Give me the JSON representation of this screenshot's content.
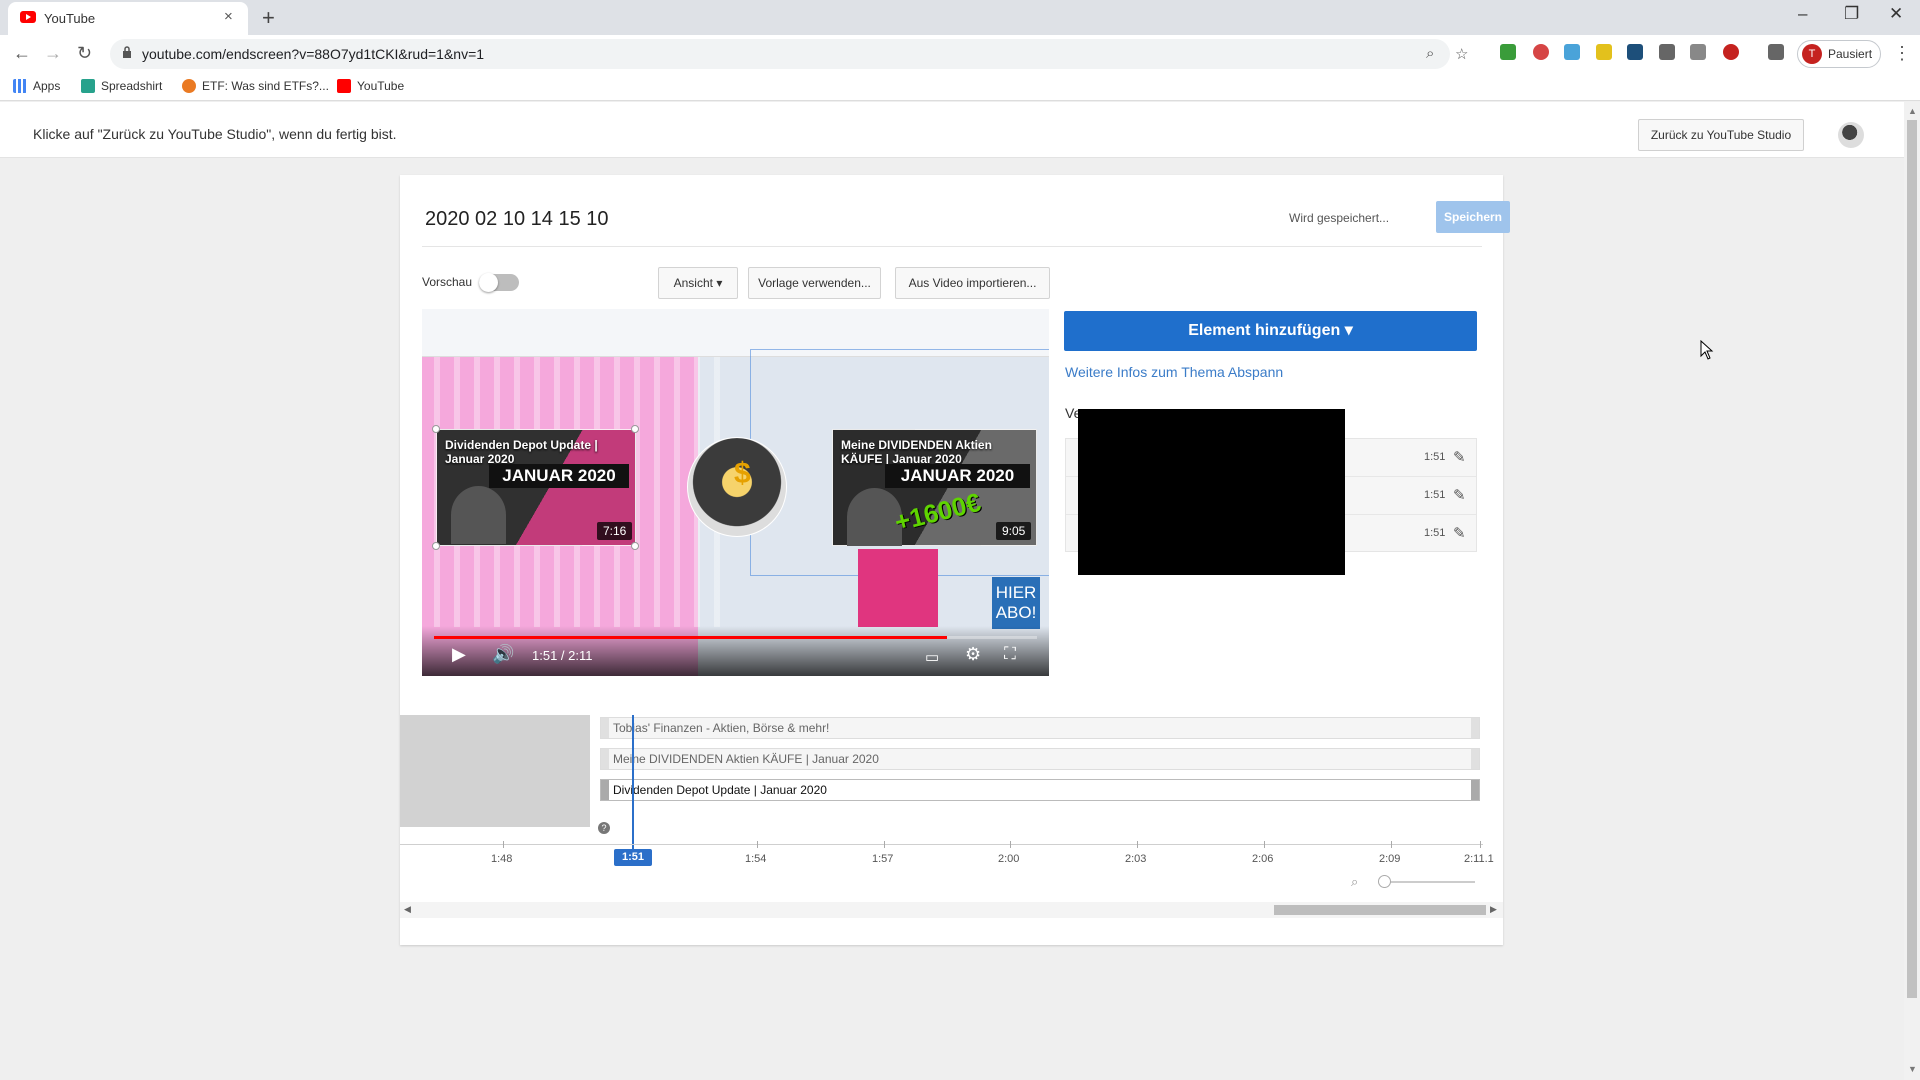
{
  "browser": {
    "tab_title": "YouTube",
    "tab_close": "×",
    "new_tab": "+",
    "window_minimize": "–",
    "window_restore": "❐",
    "window_close": "✕",
    "url": "youtube.com/endscreen?v=88O7yd1tCKI&rud=1&nv=1",
    "profile_label": "Pausiert",
    "profile_initial": "T",
    "bookmarks": [
      "Apps",
      "Spreadshirt",
      "ETF: Was sind ETFs?...",
      "YouTube"
    ]
  },
  "studio": {
    "hint": "Klicke auf \"Zurück zu YouTube Studio\", wenn du fertig bist.",
    "back_button": "Zurück zu YouTube Studio"
  },
  "editor": {
    "video_title": "2020 02 10 14 15 10",
    "saving_status": "Wird gespeichert...",
    "save_button": "Speichern",
    "preview_label": "Vorschau",
    "preview_on": false,
    "view_button": "Ansicht",
    "template_button": "Vorlage verwenden...",
    "import_button": "Aus Video importieren..."
  },
  "player": {
    "time": "1:51 / 2:11",
    "progress": 0.85,
    "element_left_title": "Dividenden Depot Update | Januar 2020",
    "element_left_banner": "JANUAR 2020",
    "element_left_duration": "7:16",
    "element_right_title": "Meine DIVIDENDEN Aktien KÄUFE | Januar 2020",
    "element_right_banner": "JANUAR 2020",
    "element_right_duration": "9:05",
    "overlay_text": "+1600€",
    "hier_abo": "HIER ABO!",
    "dollar": "$"
  },
  "panel": {
    "add_element_button": "Element hinzufügen",
    "more_info_link": "Weitere Infos zum Thema Abspann",
    "used_label_prefix": "Ve",
    "elements": [
      {
        "time": "1:51"
      },
      {
        "time": "1:51"
      },
      {
        "time": "1:51"
      }
    ]
  },
  "timeline": {
    "tracks": [
      "Tobias' Finanzen - Aktien, Börse & mehr!",
      "Meine DIVIDENDEN Aktien KÄUFE | Januar 2020",
      "Dividenden Depot Update | Januar 2020"
    ],
    "help": "?",
    "ticks": [
      "1:48",
      "1:54",
      "1:57",
      "2:00",
      "2:03",
      "2:06",
      "2:09",
      "2:11.1"
    ],
    "current": "1:51"
  }
}
